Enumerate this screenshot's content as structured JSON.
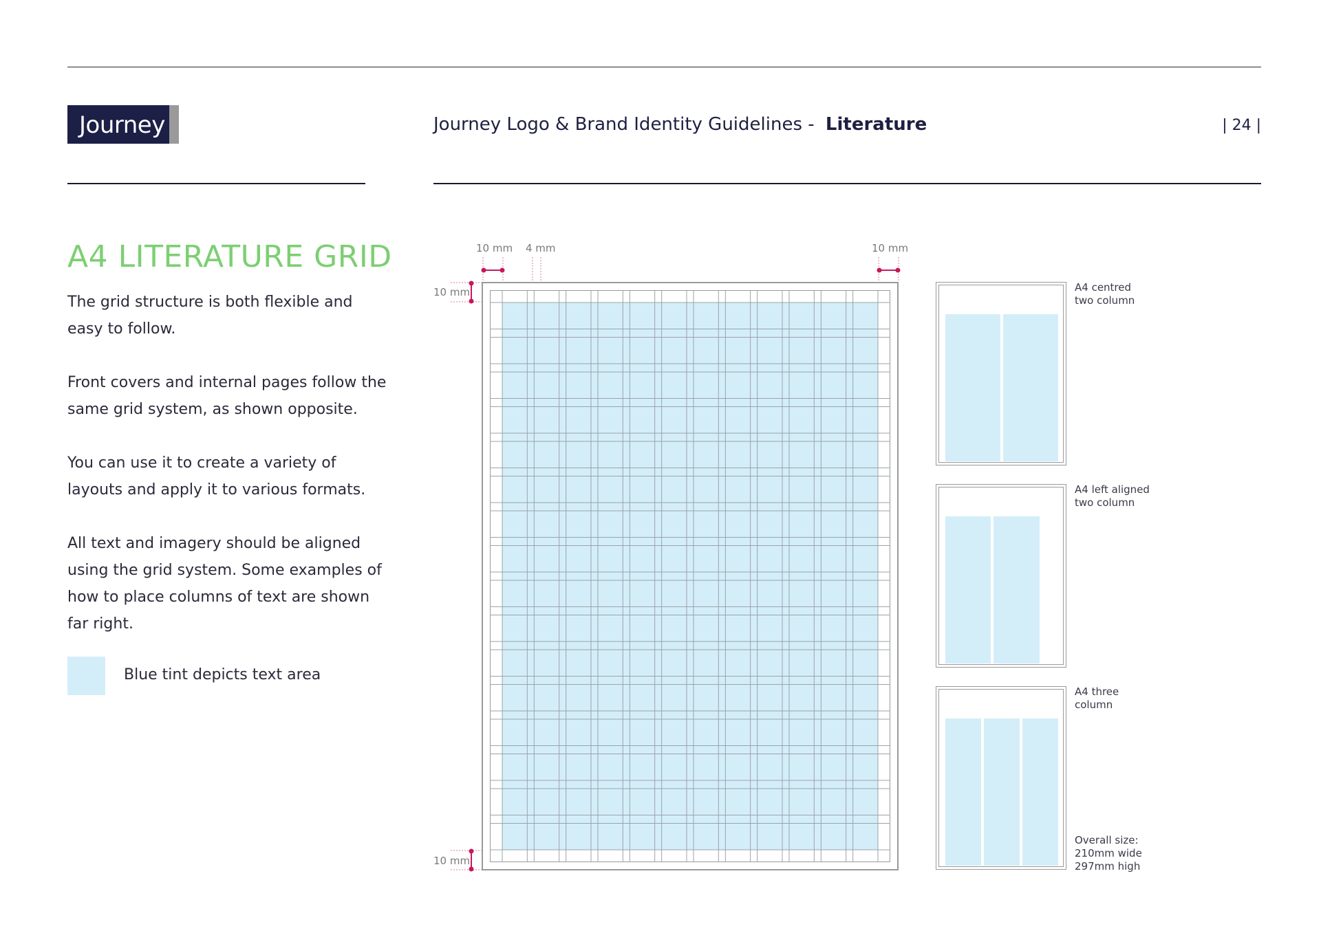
{
  "header": {
    "logo_text": "Journey",
    "title": "Journey Logo & Brand Identity Guidelines - ",
    "title_bold": "Literature",
    "page_number": "| 24 |"
  },
  "section": {
    "title": "A4 LITERATURE GRID",
    "paragraphs": [
      "The grid structure is both flexible and easy to follow.",
      "Front covers and internal pages follow the same grid system, as shown opposite.",
      "You can use it to create a variety of layouts and apply it to various formats.",
      "All text and imagery should be aligned using the grid system. Some examples of how to place columns of text are shown far right."
    ],
    "legend": "Blue tint depicts text area"
  },
  "diagram": {
    "dim_top_left": "10 mm",
    "dim_gutter": "4 mm",
    "dim_top_right": "10 mm",
    "dim_left_top": "10 mm",
    "dim_left_bottom": "10 mm"
  },
  "thumbnails": [
    {
      "label_line1": "A4 centred",
      "label_line2": "two column"
    },
    {
      "label_line1": "A4 left aligned",
      "label_line2": "two column"
    },
    {
      "label_line1": "A4 three",
      "label_line2": "column"
    }
  ],
  "overall_size": {
    "line1": "Overall size:",
    "line2": "210mm wide",
    "line3": "297mm high"
  },
  "colors": {
    "brand_navy": "#1c1f46",
    "heading_green": "#7ccf72",
    "text_tint": "#d4eef9",
    "dimension_magenta": "#c8175d"
  }
}
